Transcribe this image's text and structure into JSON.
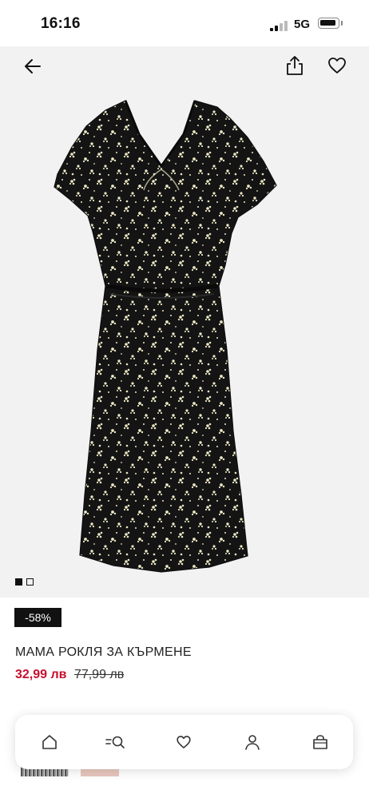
{
  "status_bar": {
    "time": "16:16",
    "network": "5G"
  },
  "top_bar": {
    "back_icon": "arrow-left-icon",
    "share_icon": "share-icon",
    "favorite_icon": "heart-icon"
  },
  "gallery": {
    "image": "black floral print dress",
    "image_count": 2,
    "active_index": 1
  },
  "product": {
    "discount_badge": "-58%",
    "title": "МАМА РОКЛЯ ЗА КЪРМЕНЕ",
    "price_current": "32,99 лв",
    "price_original": "77,99 лв"
  },
  "bottom_nav": {
    "items": [
      {
        "icon": "home-icon"
      },
      {
        "icon": "search-icon"
      },
      {
        "icon": "heart-icon"
      },
      {
        "icon": "user-icon"
      },
      {
        "icon": "bag-icon"
      }
    ]
  },
  "colors": {
    "sale_price": "#c8102e",
    "badge_background": "#111111",
    "gallery_background": "#f2f2f2"
  }
}
